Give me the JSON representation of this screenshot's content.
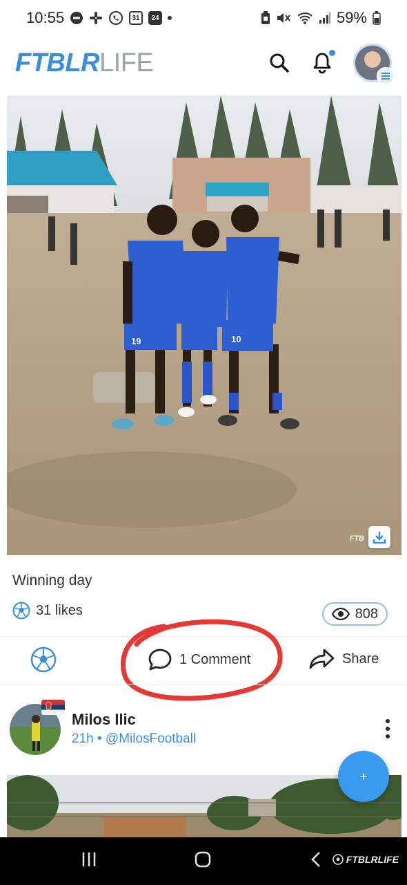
{
  "status_bar": {
    "time": "10:55",
    "calendar_day": "31",
    "calendar_day2": "24",
    "battery": "59%"
  },
  "header": {
    "logo_bold": "FTBLR",
    "logo_light": "LIFE"
  },
  "post": {
    "watermark": "FTB",
    "caption": "Winning day",
    "likes": "31 likes",
    "views": "808"
  },
  "actions": {
    "comment": "1 Comment",
    "share": "Share"
  },
  "next_post": {
    "author": "Milos Ilic",
    "meta": "21h • @MilosFootball"
  },
  "fab": {
    "label": "+"
  },
  "nav": {
    "watermark": "FTBLRLIFE"
  },
  "colors": {
    "accent": "#3a8fd8",
    "annotation": "#e53935"
  }
}
